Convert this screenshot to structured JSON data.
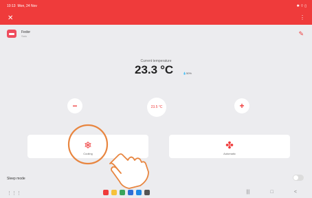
{
  "status_bar": {
    "time": "10:13",
    "date": "Mon, 24 Nov",
    "right_icons": "✱ ⌔ ▯"
  },
  "app_bar": {
    "close_glyph": "✕",
    "more_glyph": "⋮"
  },
  "device": {
    "name": "Fedor",
    "subtitle": "Salo"
  },
  "edit_glyph": "✎",
  "reading": {
    "label": "Current temperature",
    "value": "23.3",
    "unit": "°C",
    "humidity": "50%"
  },
  "controls": {
    "minus_label": "−",
    "plus_label": "+",
    "setpoint": "23.5 °C"
  },
  "modes": [
    {
      "label": "Cooling",
      "icon": "snowflake-icon",
      "glyph": "❄"
    },
    {
      "label": "Automatic",
      "icon": "fan-icon",
      "glyph": "✤"
    }
  ],
  "sleep_mode": {
    "label": "Sleep mode",
    "enabled": false
  },
  "nav": {
    "apps_glyph": "⋮⋮⋮",
    "recents": "|||",
    "home": "□",
    "back": "<"
  },
  "colors": {
    "accent": "#ef3b3b",
    "background": "#ececef",
    "card": "#ffffff"
  }
}
